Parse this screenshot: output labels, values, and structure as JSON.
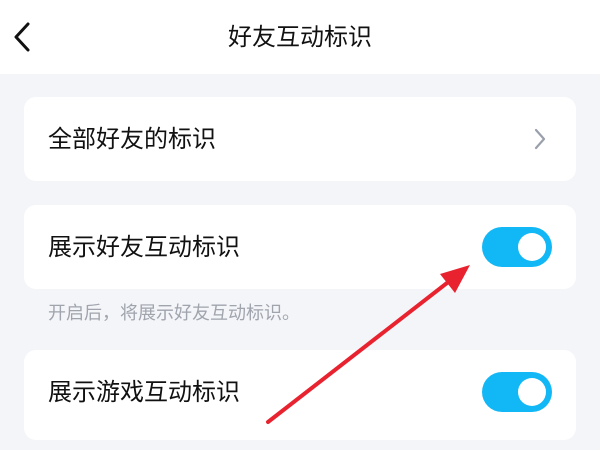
{
  "header": {
    "title": "好友互动标识"
  },
  "items": [
    {
      "label": "全部好友的标识"
    },
    {
      "label": "展示好友互动标识",
      "enabled": true
    },
    {
      "label": "展示游戏互动标识",
      "enabled": true
    }
  ],
  "hints": [
    "开启后，将展示好友互动标识。"
  ],
  "colors": {
    "accent": "#12b7f5",
    "annotation_arrow": "#e8232f",
    "background": "#f4f5f9"
  },
  "icons": {
    "back": "chevron-left-icon",
    "more": "chevron-right-icon"
  }
}
